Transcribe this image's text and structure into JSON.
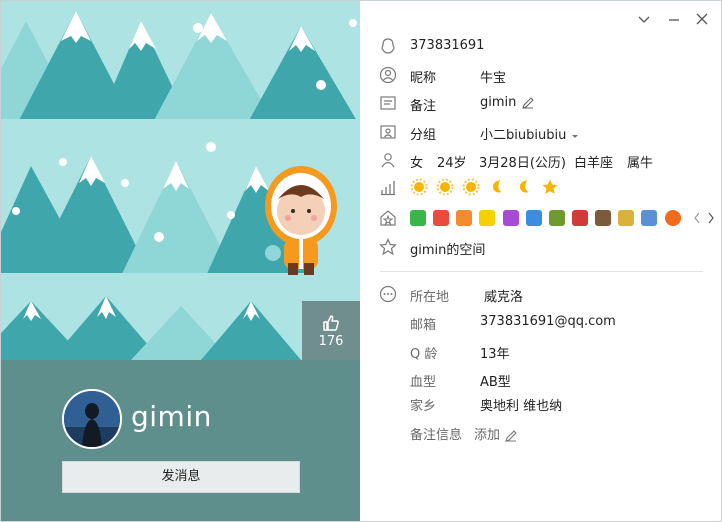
{
  "profile": {
    "qq_number": "373831691",
    "nickname_label": "昵称",
    "nickname": "牛宝",
    "remark_label": "备注",
    "remark": "gimin",
    "group_label": "分组",
    "group": "小二biubiubiu",
    "gender": "女",
    "age": "24岁",
    "birthday": "3月28日(公历)",
    "constellation": "白羊座",
    "zodiac": "属牛",
    "space_link": "gimin的空间"
  },
  "level": {
    "suns": 3,
    "moons": 2,
    "stars": 1
  },
  "details": {
    "location_label": "所在地",
    "location": "威克洛",
    "email_label": "邮箱",
    "email": "373831691@qq.com",
    "qage_label": "Q 龄",
    "qage": "13年",
    "blood_label": "血型",
    "blood": "AB型",
    "hometown_label": "家乡",
    "hometown": "奥地利 维也纳",
    "note_label": "备注信息",
    "note_add": "添加"
  },
  "left": {
    "username": "gimin",
    "like_count": "176",
    "send_message_label": "发消息"
  },
  "colors": {
    "sky": "#aee3e3",
    "tree_dark": "#3fa7ac",
    "tree_light": "#8fd6d6",
    "panel": "#5e8f8c",
    "accent_orange": "#f59a1e"
  },
  "icons": [
    "qq-penguin-icon",
    "user-circle-icon",
    "card-icon",
    "group-icon",
    "person-icon",
    "level-bars-icon",
    "badge-house-icon",
    "star-outline-icon",
    "more-dots-icon",
    "pencil-icon",
    "dropdown-caret-icon",
    "thumbs-up-icon",
    "minimize-icon",
    "close-icon",
    "chevron-down-icon"
  ]
}
